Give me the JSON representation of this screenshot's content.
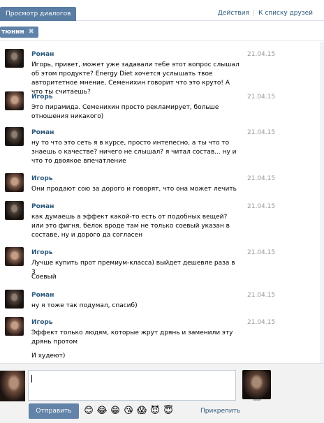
{
  "tabs": {
    "active": "Просмотр диалогов"
  },
  "top_links": {
    "actions": "Действия",
    "separator": "|",
    "to_friends": "К списку друзей"
  },
  "recipient": {
    "name": "тюнин",
    "close": "✖"
  },
  "messages": [
    {
      "author": "Роман",
      "avatar": "roman",
      "date": "21.04.15",
      "text": "Игорь, привет, может уже задавали тебе этот вопрос слышал об этом продукте? Energy Diet хочется услышать твое авторитетное мнение, Семенихин говорит что это круто! А что ты считаешь?"
    },
    {
      "author": "Игорь",
      "avatar": "igor",
      "date": "21.04.15",
      "text": "Это пирамида. Семенихин просто рекламирует, больше отношения никакого)"
    },
    {
      "author": "Роман",
      "avatar": "roman",
      "date": "21.04.15",
      "text": "ну то что это сеть я в курсе, просто интепесно, а ты что то знаешь о качестве? ничего не слышал? я читал состав... ну и что то двоякое впечатление"
    },
    {
      "author": "Игорь",
      "avatar": "igor",
      "date": "21.04.15",
      "text": "Они продают сою за дорого и говорят, что она может лечить"
    },
    {
      "author": "Роман",
      "avatar": "roman",
      "date": "21.04.15",
      "text": "как думаешь а эффект какой-то есть от подобных вещей? или это фигня, белок вроде там не только соевый указан в составе, ну и дорого да согласен"
    },
    {
      "author": "Игорь",
      "avatar": "igor",
      "date": "21.04.15",
      "text": "Лучше купить прот премиум-класса) выйдет дешевле раза в 3",
      "extra": "Соевый"
    },
    {
      "author": "Роман",
      "avatar": "roman",
      "date": "21.04.15",
      "text": "ну я тоже так подумал, спасиб)"
    },
    {
      "author": "Игорь",
      "avatar": "igor",
      "date": "21.04.15",
      "text": "Эффект только людям, которые жрут дрянь и заменили эту дрянь протом",
      "extra": "И худеют)"
    }
  ],
  "composer": {
    "input_value": "",
    "send_label": "Отправить",
    "attach_label": "Прикрепить",
    "emojis": [
      "😊",
      "😂",
      "😁",
      "😘",
      "😱",
      "😈",
      "😇"
    ],
    "smile_icon": "smile-icon",
    "camera_icon": "camera-icon"
  }
}
